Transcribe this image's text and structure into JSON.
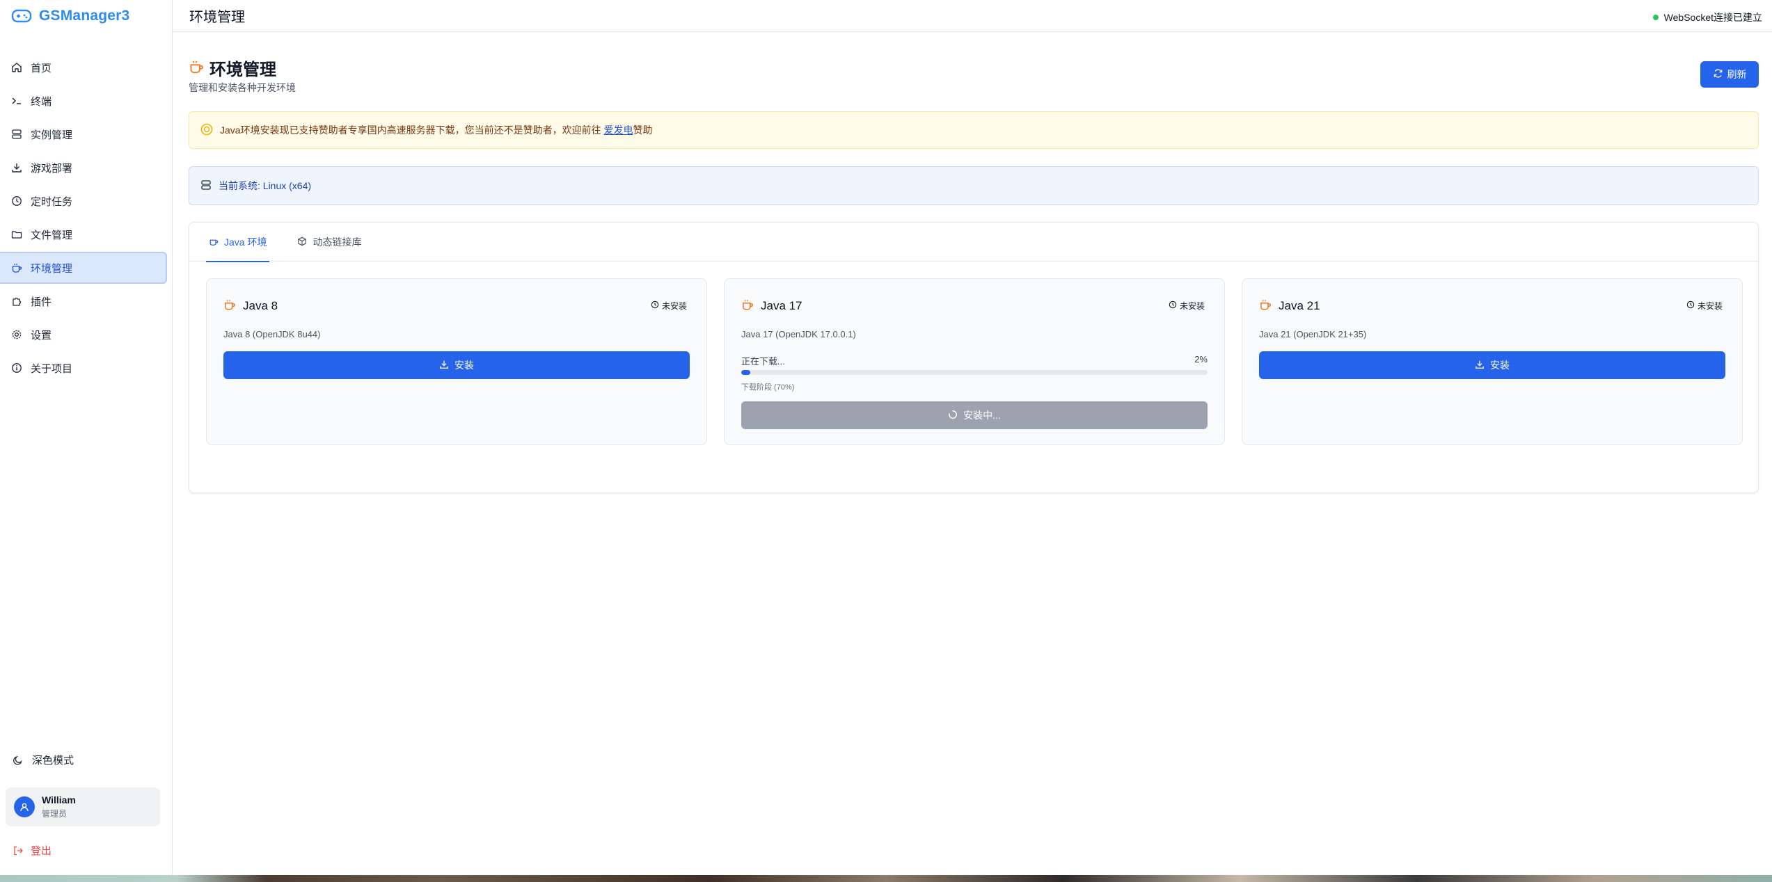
{
  "brand": {
    "name": "GSManager3",
    "icon": "gamepad-icon",
    "color": "#2d8cf0"
  },
  "header": {
    "title": "环境管理",
    "ws_status": "WebSocket连接已建立"
  },
  "sidebar": {
    "items": [
      {
        "label": "首页",
        "icon": "home-icon"
      },
      {
        "label": "终端",
        "icon": "terminal-icon"
      },
      {
        "label": "实例管理",
        "icon": "server-icon"
      },
      {
        "label": "游戏部署",
        "icon": "download-icon"
      },
      {
        "label": "定时任务",
        "icon": "clock-icon"
      },
      {
        "label": "文件管理",
        "icon": "folder-icon"
      },
      {
        "label": "环境管理",
        "icon": "coffee-icon",
        "active": true
      },
      {
        "label": "插件",
        "icon": "puzzle-icon"
      },
      {
        "label": "设置",
        "icon": "gear-icon"
      },
      {
        "label": "关于项目",
        "icon": "info-icon"
      }
    ],
    "dark_mode": "深色模式",
    "user": {
      "name": "William",
      "role": "管理员"
    },
    "logout": "登出"
  },
  "page": {
    "title": "环境管理",
    "subtitle": "管理和安装各种开发环境",
    "refresh": "刷新"
  },
  "notice": {
    "text": "Java环境安装现已支持赞助者专享国内高速服务器下载，您当前还不是赞助者，欢迎前往 ",
    "link": "爱发电",
    "suffix": "赞助"
  },
  "system": {
    "text": "当前系统: Linux (x64)"
  },
  "tabs": [
    {
      "label": "Java 环境",
      "icon": "coffee-icon",
      "active": true
    },
    {
      "label": "动态链接库",
      "icon": "package-icon"
    }
  ],
  "cards": [
    {
      "title": "Java 8",
      "status": "未安装",
      "desc": "Java 8 (OpenJDK 8u44)",
      "action": "安装"
    },
    {
      "title": "Java 17",
      "status": "未安装",
      "desc": "Java 17 (OpenJDK 17.0.0.1)",
      "progress_label": "正在下载...",
      "progress_pct": "2%",
      "progress_value": 2,
      "stage": "下载阶段 (70%)",
      "action": "安装中..."
    },
    {
      "title": "Java 21",
      "status": "未安装",
      "desc": "Java 21 (OpenJDK 21+35)",
      "action": "安装"
    }
  ],
  "colors": {
    "accent": "#2563eb",
    "coffee": "#f97316",
    "success": "#22c55e",
    "danger": "#ef4444"
  }
}
